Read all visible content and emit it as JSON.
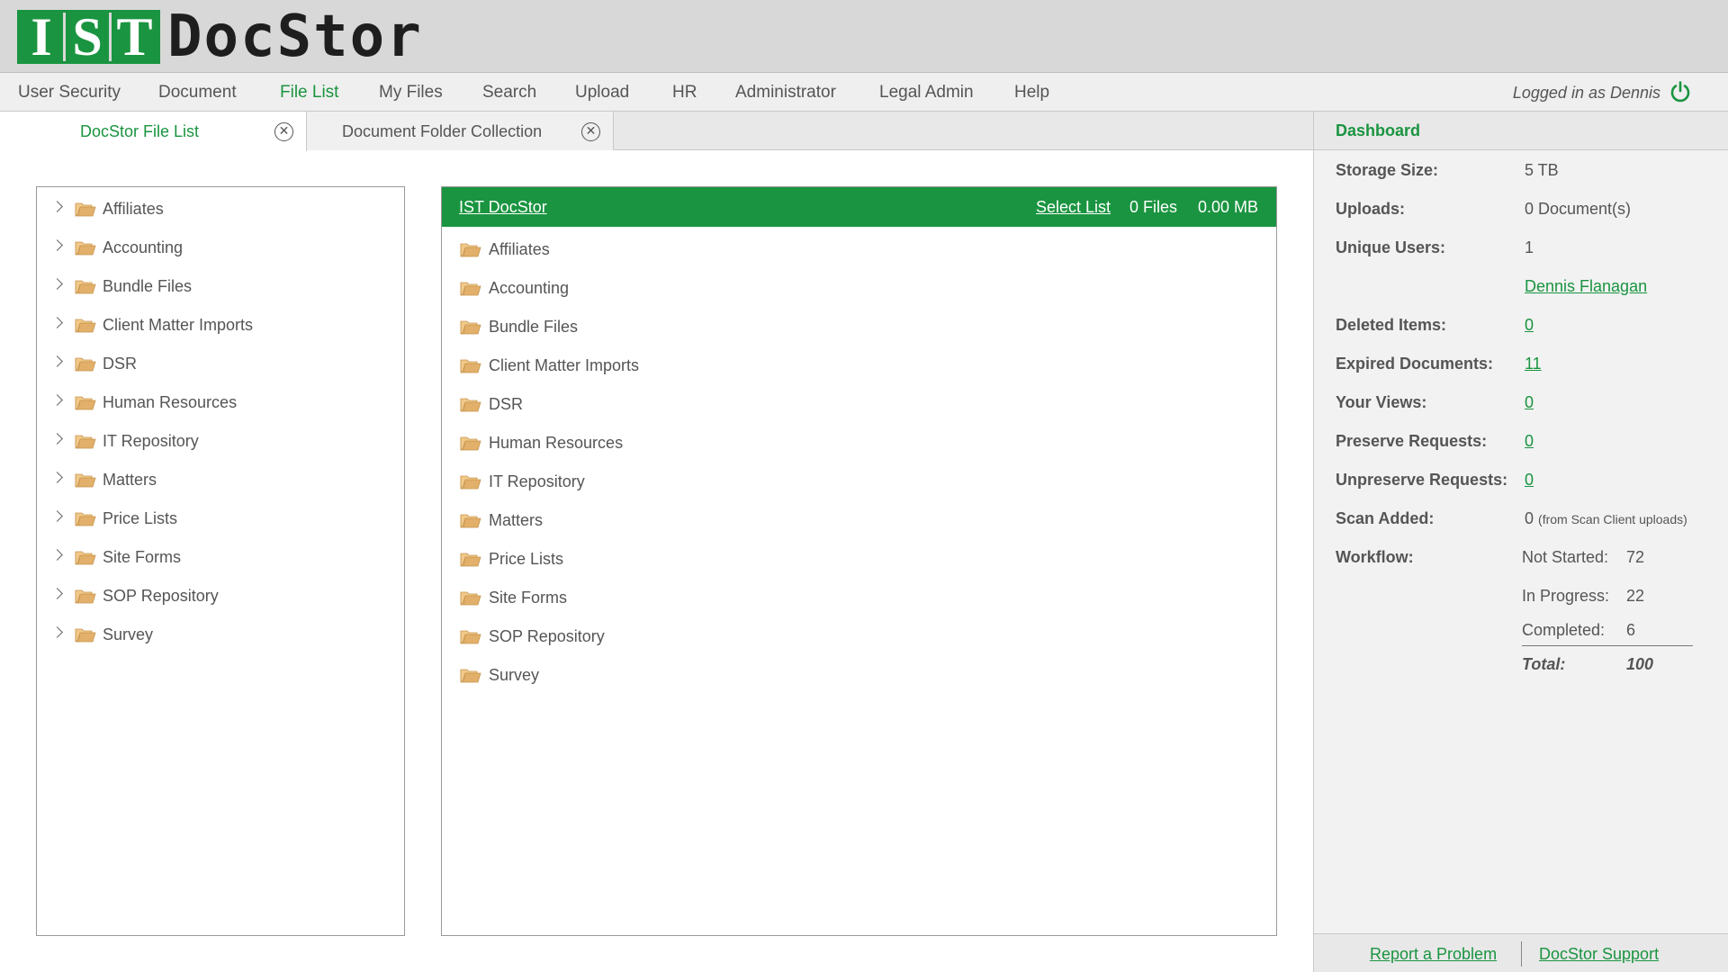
{
  "logo": {
    "letters": [
      "I",
      "S",
      "T"
    ],
    "text": "DocStor"
  },
  "nav": {
    "items": [
      {
        "label": "User Security"
      },
      {
        "label": "Document"
      },
      {
        "label": "File List",
        "active": true
      },
      {
        "label": "My Files"
      },
      {
        "label": "Search"
      },
      {
        "label": "Upload"
      },
      {
        "label": "HR"
      },
      {
        "label": "Administrator"
      },
      {
        "label": "Legal Admin"
      },
      {
        "label": "Help"
      }
    ],
    "logged_in": "Logged in as Dennis",
    "power_icon": "power-icon"
  },
  "tabs": [
    {
      "label": "DocStor File List",
      "active": true,
      "close_icon": "close-circle-icon"
    },
    {
      "label": "Document Folder Collection",
      "active": false,
      "close_icon": "close-circle-icon"
    }
  ],
  "tree": {
    "items": [
      "Affiliates",
      "Accounting",
      "Bundle Files",
      "Client Matter Imports",
      "DSR",
      "Human Resources",
      "IT Repository",
      "Matters",
      "Price Lists",
      "Site Forms",
      "SOP Repository",
      "Survey"
    ]
  },
  "filelist": {
    "title": "IST DocStor",
    "select_list": "Select List",
    "files": "0 Files",
    "size": "0.00 MB",
    "items": [
      "Affiliates",
      "Accounting",
      "Bundle Files",
      "Client Matter Imports",
      "DSR",
      "Human Resources",
      "IT Repository",
      "Matters",
      "Price Lists",
      "Site Forms",
      "SOP Repository",
      "Survey"
    ]
  },
  "dashboard": {
    "title": "Dashboard",
    "storage_label": "Storage Size:",
    "storage_value": "5 TB",
    "uploads_label": "Uploads:",
    "uploads_value": "0 Document(s)",
    "users_label": "Unique Users:",
    "users_value": "1",
    "user_name": "Dennis Flanagan",
    "deleted_label": "Deleted Items:",
    "deleted_value": "0",
    "expired_label": "Expired Documents:",
    "expired_value": "11",
    "views_label": "Your Views:",
    "views_value": "0",
    "preserve_label": "Preserve Requests:",
    "preserve_value": "0",
    "unpreserve_label": "Unpreserve Requests:",
    "unpreserve_value": "0",
    "scan_label": "Scan Added:",
    "scan_value": "0",
    "scan_note": "(from Scan Client uploads)",
    "workflow_label": "Workflow:",
    "workflow": {
      "not_started_label": "Not Started:",
      "not_started": "72",
      "in_progress_label": "In Progress:",
      "in_progress": "22",
      "completed_label": "Completed:",
      "completed": "6",
      "total_label": "Total:",
      "total": "100"
    },
    "footer": {
      "report": "Report a Problem",
      "support": "DocStor Support"
    }
  },
  "colors": {
    "accent": "#1a9440",
    "folder": "#e2b06a"
  }
}
